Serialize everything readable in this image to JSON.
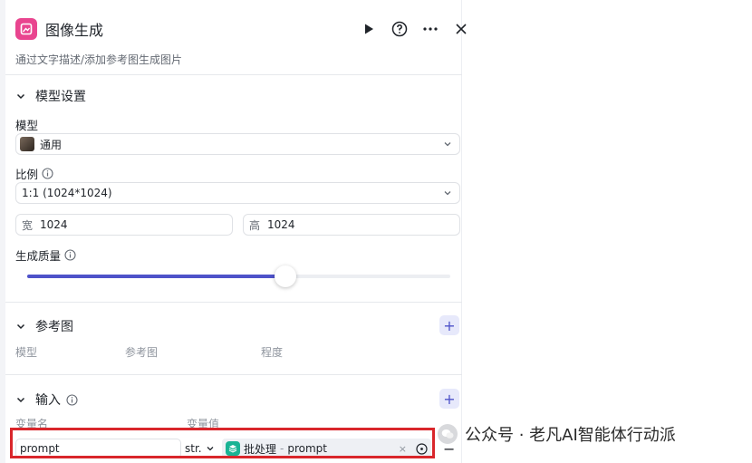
{
  "header": {
    "title": "图像生成",
    "description": "通过文字描述/添加参考图生成图片",
    "icons": [
      "run-icon",
      "help-icon",
      "more-icon",
      "close-icon"
    ]
  },
  "model_settings": {
    "section_title": "模型设置",
    "model_label": "模型",
    "model_value": "通用",
    "ratio_label": "比例",
    "ratio_value": "1:1 (1024*1024)",
    "width_prefix": "宽",
    "width_value": "1024",
    "height_prefix": "高",
    "height_value": "1024",
    "quality_label": "生成质量",
    "quality_level": 0.61
  },
  "reference": {
    "section_title": "参考图",
    "columns": [
      "模型",
      "参考图",
      "程度"
    ]
  },
  "input": {
    "section_title": "输入",
    "columns": [
      "变量名",
      "变量值"
    ],
    "rows": [
      {
        "name": "prompt",
        "type": "str.",
        "ref_node": "批处理",
        "ref_sep": "-",
        "ref_var": "prompt",
        "clear": "×",
        "remove": "−"
      }
    ]
  },
  "watermark": {
    "text": "公众号 · 老凡AI智能体行动派"
  },
  "colors": {
    "accent": "#4e52c9",
    "brand_icon": "#e9458f",
    "highlight_border": "#d9262b",
    "ref_chip": "#19b394"
  }
}
